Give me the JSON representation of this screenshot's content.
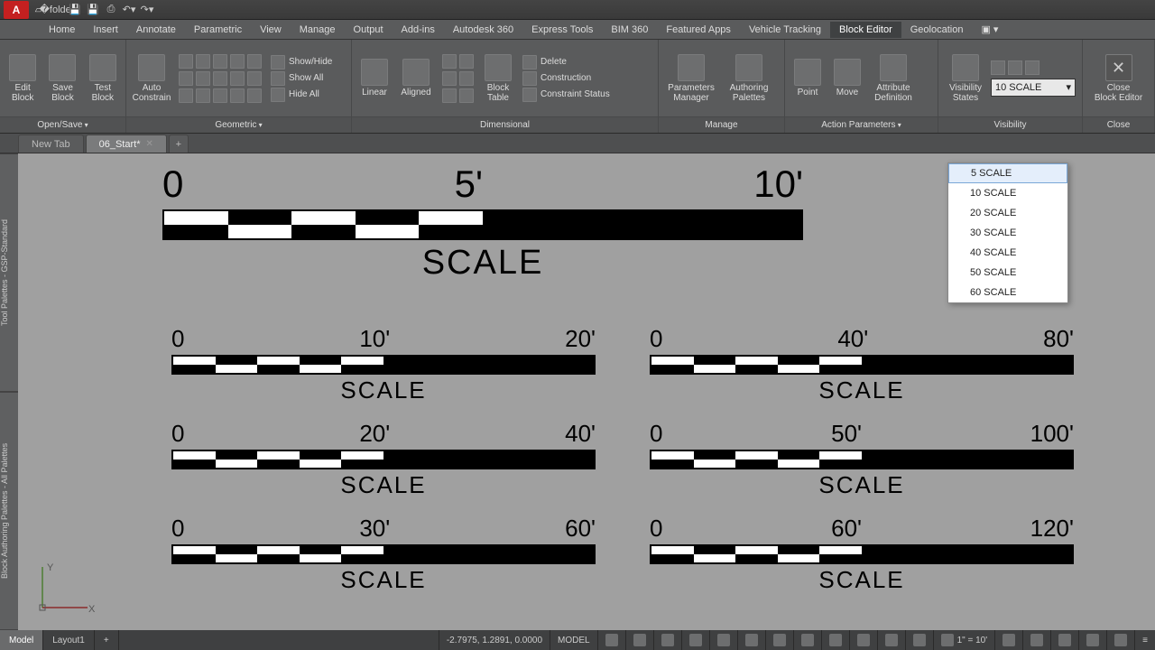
{
  "app": {
    "logo": "A"
  },
  "menu": [
    "Home",
    "Insert",
    "Annotate",
    "Parametric",
    "View",
    "Manage",
    "Output",
    "Add-ins",
    "Autodesk 360",
    "Express Tools",
    "BIM 360",
    "Featured Apps",
    "Vehicle Tracking",
    "Block Editor",
    "Geolocation",
    "▣ ▾"
  ],
  "active_menu": "Block Editor",
  "ribbon": {
    "open_save": {
      "title": "Open/Save",
      "edit": "Edit\nBlock",
      "save": "Save\nBlock",
      "test": "Test\nBlock"
    },
    "auto_constrain": "Auto\nConstrain",
    "geometric": {
      "title": "Geometric",
      "show_hide": "Show/Hide",
      "show_all": "Show All",
      "hide_all": "Hide All"
    },
    "dimensional": {
      "title": "Dimensional",
      "linear": "Linear",
      "aligned": "Aligned",
      "block_table": "Block\nTable",
      "delete": "Delete",
      "construction": "Construction",
      "constraint_status": "Constraint Status"
    },
    "manage": {
      "title": "Manage",
      "param_mgr": "Parameters\nManager",
      "auth_pal": "Authoring\nPalettes"
    },
    "action_params": {
      "title": "Action Parameters",
      "point": "Point",
      "move": "Move",
      "attr_def": "Attribute\nDefinition"
    },
    "visibility": {
      "title": "Visibility",
      "vis_states": "Visibility\nStates",
      "selected": "10 SCALE"
    },
    "close": {
      "title": "Close",
      "btn": "Close\nBlock Editor"
    }
  },
  "doc_tabs": {
    "new": "New Tab",
    "current": "06_Start*",
    "plus": "+"
  },
  "palettes": [
    "Tool Palettes - GSP-Standard",
    "Block Authoring Palettes - All Palettes"
  ],
  "scales": {
    "main": {
      "l0": "0",
      "l1": "5'",
      "l2": "10'",
      "title": "SCALE"
    },
    "s10": {
      "l0": "0",
      "l1": "10'",
      "l2": "20'",
      "title": "SCALE"
    },
    "s40": {
      "l0": "0",
      "l1": "40'",
      "l2": "80'",
      "title": "SCALE"
    },
    "s20": {
      "l0": "0",
      "l1": "20'",
      "l2": "40'",
      "title": "SCALE"
    },
    "s50": {
      "l0": "0",
      "l1": "50'",
      "l2": "100'",
      "title": "SCALE"
    },
    "s30": {
      "l0": "0",
      "l1": "30'",
      "l2": "60'",
      "title": "SCALE"
    },
    "s60": {
      "l0": "0",
      "l1": "60'",
      "l2": "120'",
      "title": "SCALE"
    }
  },
  "vis_popup": [
    "5 SCALE",
    "10 SCALE",
    "20 SCALE",
    "30 SCALE",
    "40 SCALE",
    "50 SCALE",
    "60 SCALE"
  ],
  "vis_popup_selected": "5 SCALE",
  "status": {
    "model": "Model",
    "layout": "Layout1",
    "coords": "-2.7975, 1.2891, 0.0000",
    "space": "MODEL",
    "scale": "1\" = 10'"
  }
}
